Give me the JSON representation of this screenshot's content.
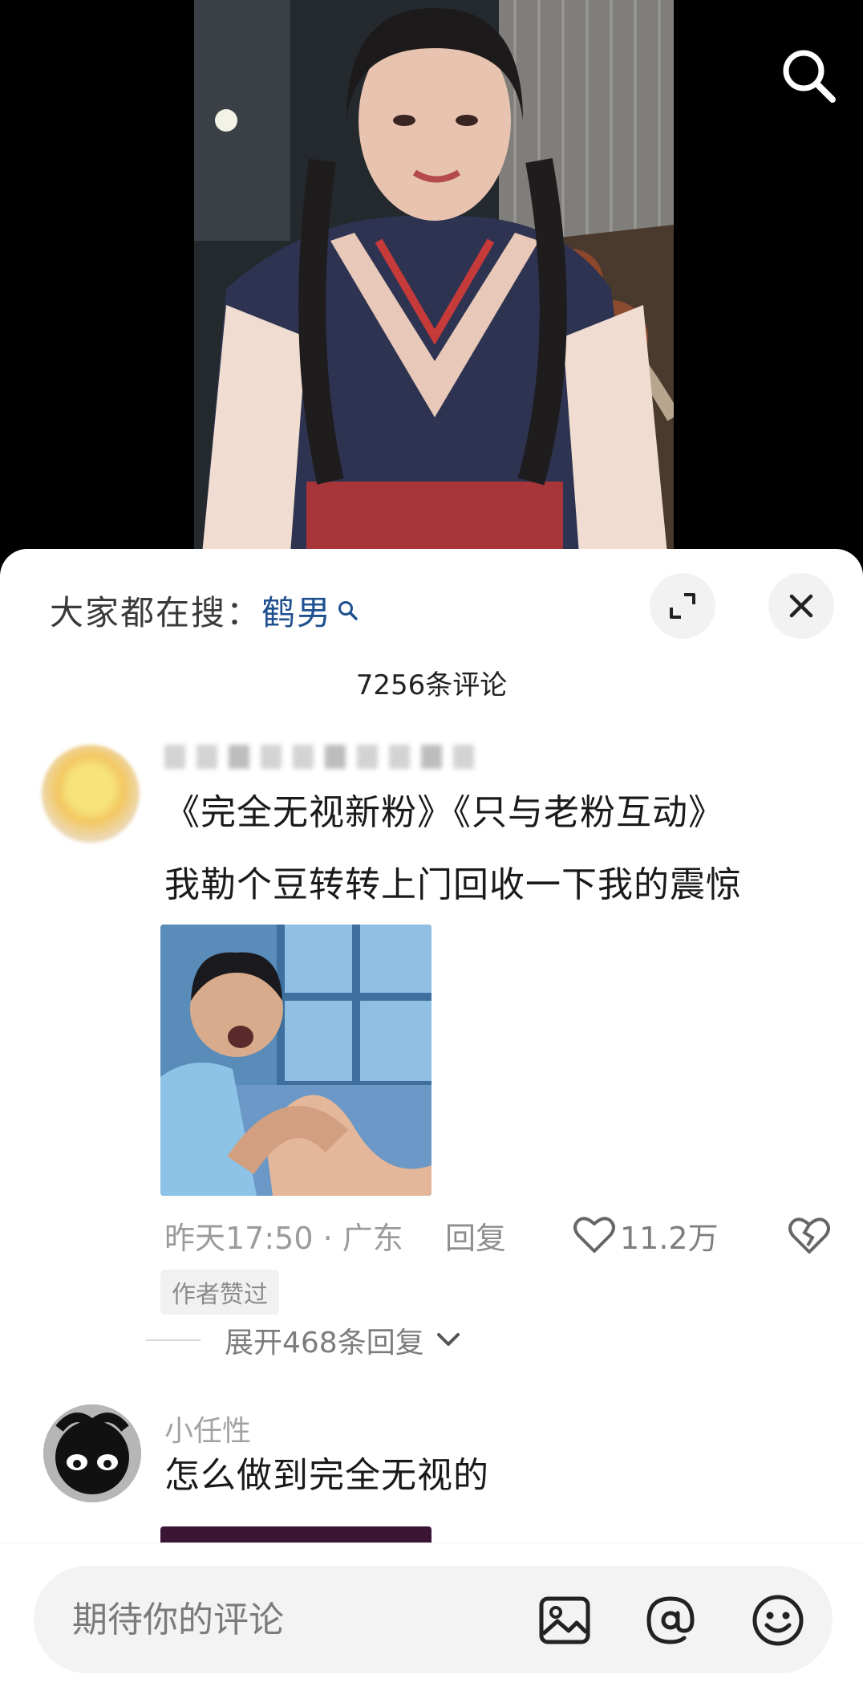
{
  "video": {
    "search_icon": "search-icon"
  },
  "sheet": {
    "hot_search_prefix": "大家都在搜：",
    "hot_search_keyword": "鹤男",
    "expand_icon": "expand-icon",
    "close_icon": "close-icon",
    "comment_count": "7256条评论"
  },
  "comments": [
    {
      "author": "",
      "text": "《完全无视新粉》《只与老粉互动》\n我勒个豆转转上门回收一下我的震惊",
      "time_location": "昨天17:50 · 广东",
      "reply_label": "回复",
      "likes": "11.2万",
      "badge": "作者赞过",
      "expand_replies": "展开468条回复"
    },
    {
      "author": "小任性",
      "text": "怎么做到完全无视的"
    }
  ],
  "input": {
    "placeholder": "期待你的评论",
    "icons": [
      "image-icon",
      "at-icon",
      "emoji-icon"
    ]
  },
  "colors": {
    "keyword": "#1e4f8f",
    "sheet_bg": "#ffffff",
    "input_bg": "#f3f3f3"
  }
}
